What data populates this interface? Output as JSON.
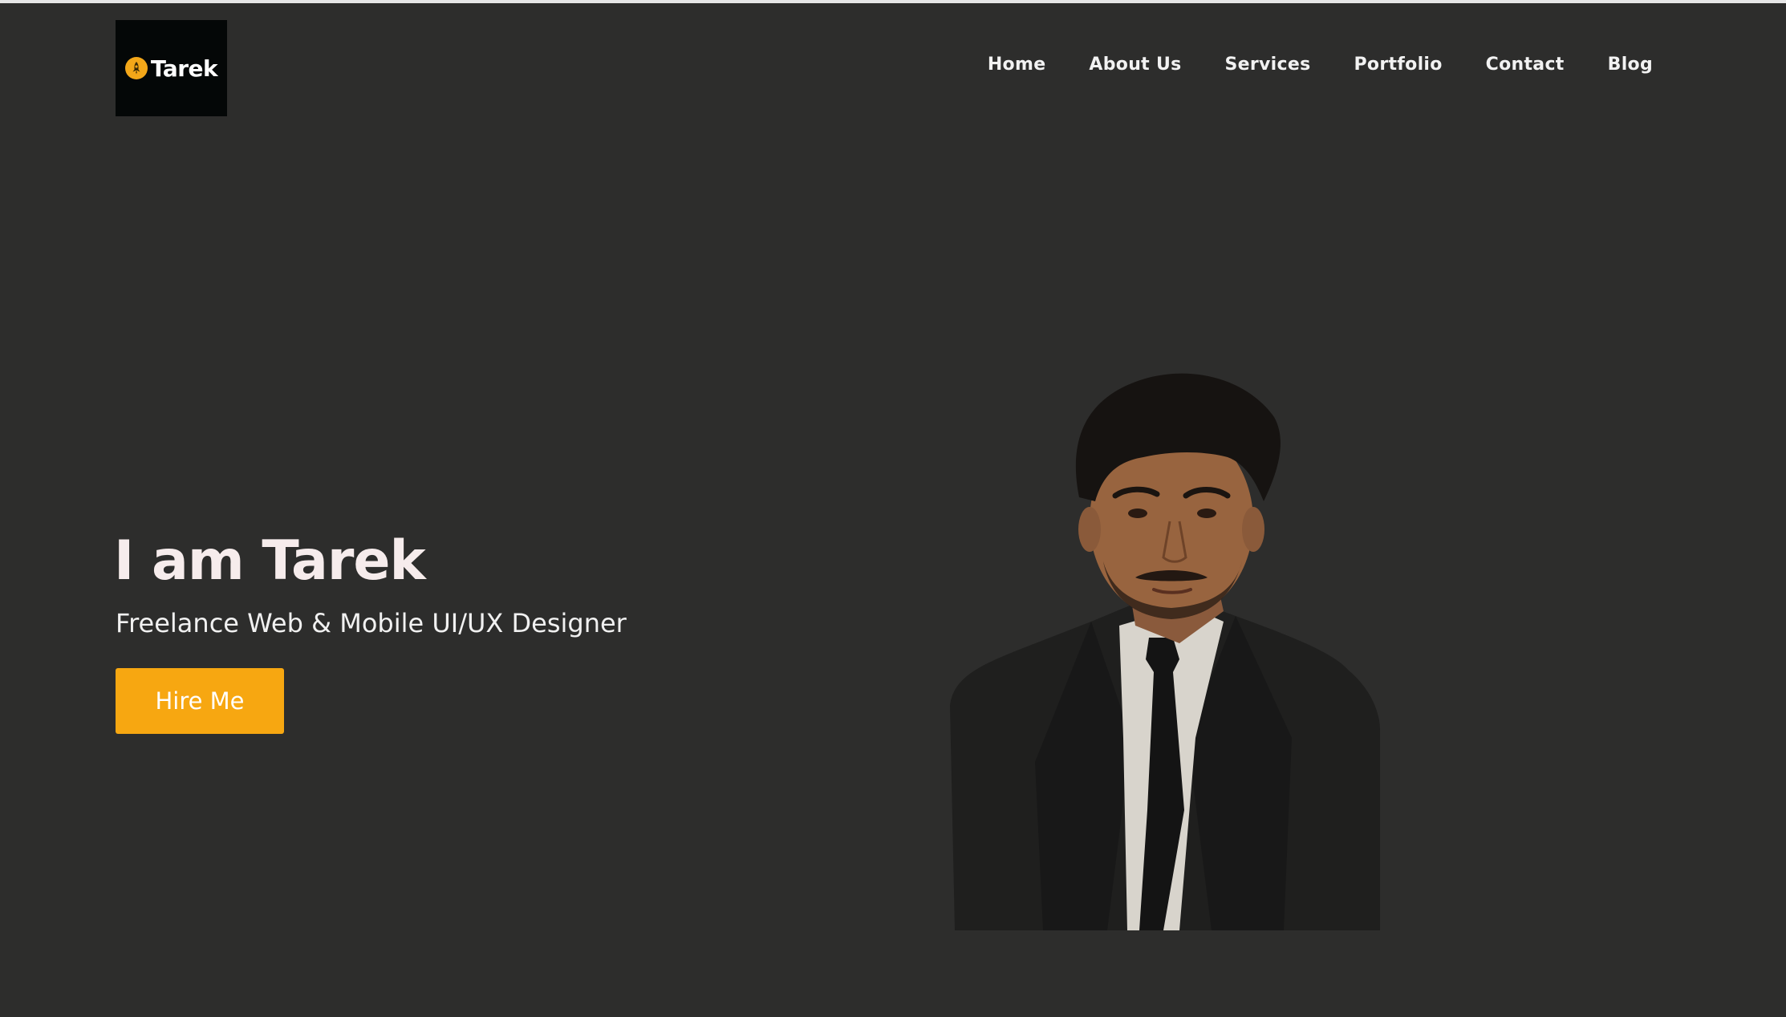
{
  "brand": {
    "logo_text": "Tarek",
    "accent_color": "#f7a711",
    "logo_icon": "rocket-icon"
  },
  "nav": {
    "items": [
      {
        "label": "Home"
      },
      {
        "label": "About Us"
      },
      {
        "label": "Services"
      },
      {
        "label": "Portfolio"
      },
      {
        "label": "Contact"
      },
      {
        "label": "Blog"
      }
    ]
  },
  "hero": {
    "title": "I am Tarek",
    "subtitle": "Freelance Web & Mobile UI/UX Designer",
    "cta_label": "Hire Me",
    "portrait": "profile-photo"
  },
  "colors": {
    "background": "#2d2d2c",
    "logo_background": "#040707",
    "text": "#f1f1f1"
  }
}
